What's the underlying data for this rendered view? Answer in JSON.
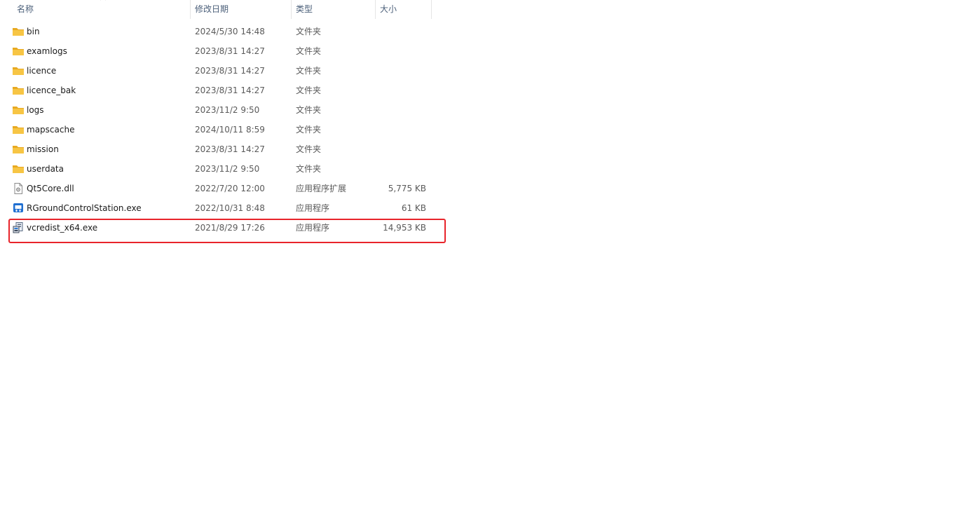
{
  "columns": {
    "name": "名称",
    "date": "修改日期",
    "type": "类型",
    "size": "大小"
  },
  "sort": {
    "column": "name",
    "direction": "ascending"
  },
  "files": [
    {
      "name": "bin",
      "date": "2024/5/30 14:48",
      "type": "文件夹",
      "size": "",
      "icon": "folder-icon"
    },
    {
      "name": "examlogs",
      "date": "2023/8/31 14:27",
      "type": "文件夹",
      "size": "",
      "icon": "folder-icon"
    },
    {
      "name": "licence",
      "date": "2023/8/31 14:27",
      "type": "文件夹",
      "size": "",
      "icon": "folder-icon"
    },
    {
      "name": "licence_bak",
      "date": "2023/8/31 14:27",
      "type": "文件夹",
      "size": "",
      "icon": "folder-icon"
    },
    {
      "name": "logs",
      "date": "2023/11/2 9:50",
      "type": "文件夹",
      "size": "",
      "icon": "folder-icon"
    },
    {
      "name": "mapscache",
      "date": "2024/10/11 8:59",
      "type": "文件夹",
      "size": "",
      "icon": "folder-icon"
    },
    {
      "name": "mission",
      "date": "2023/8/31 14:27",
      "type": "文件夹",
      "size": "",
      "icon": "folder-icon"
    },
    {
      "name": "userdata",
      "date": "2023/11/2 9:50",
      "type": "文件夹",
      "size": "",
      "icon": "folder-icon"
    },
    {
      "name": "Qt5Core.dll",
      "date": "2022/7/20 12:00",
      "type": "应用程序扩展",
      "size": "5,775 KB",
      "icon": "dll-file-icon"
    },
    {
      "name": "RGroundControlStation.exe",
      "date": "2022/10/31 8:48",
      "type": "应用程序",
      "size": "61 KB",
      "icon": "application-icon"
    },
    {
      "name": "vcredist_x64.exe",
      "date": "2021/8/29 17:26",
      "type": "应用程序",
      "size": "14,953 KB",
      "icon": "installer-icon"
    }
  ],
  "colors": {
    "folder": "#f7c544",
    "folder_dark": "#e8a921",
    "highlight": "#e8242b",
    "header_text": "#4c607a"
  }
}
